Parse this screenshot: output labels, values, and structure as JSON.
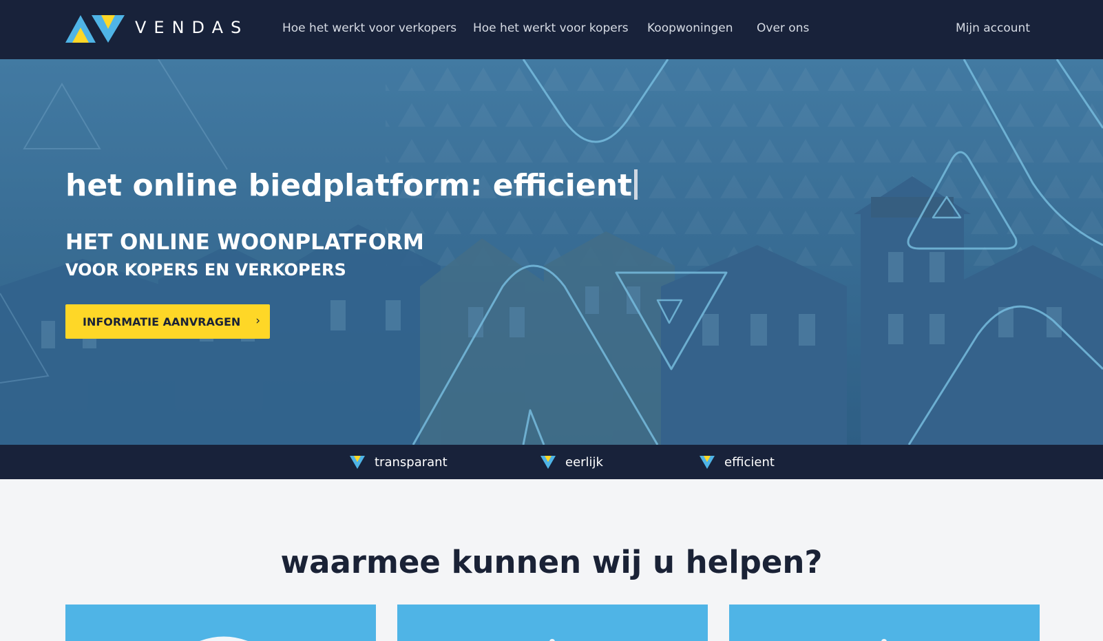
{
  "header": {
    "brand": "VENDAS",
    "nav": [
      "Hoe het werkt voor verkopers",
      "Hoe het werkt voor kopers",
      "Koopwoningen",
      "Over ons"
    ],
    "account": "Mijn account"
  },
  "hero": {
    "title": "het online biedplatform: efficient",
    "subtitle_line1": "HET ONLINE WOONPLATFORM",
    "subtitle_line2": "VOOR KOPERS EN VERKOPERS",
    "cta_label": "INFORMATIE AANVRAGEN",
    "cta_icon": "chevron-right-icon"
  },
  "usps": [
    {
      "icon": "vendas-v-icon",
      "label": "transparant"
    },
    {
      "icon": "vendas-v-icon",
      "label": "eerlijk"
    },
    {
      "icon": "vendas-v-icon",
      "label": "efficient"
    }
  ],
  "help": {
    "title": "waarmee kunnen wij u helpen?"
  },
  "colors": {
    "navy": "#18223a",
    "accent_yellow": "#fed727",
    "accent_blue": "#4fb4e6",
    "hero_blue": "#3c6b91"
  }
}
